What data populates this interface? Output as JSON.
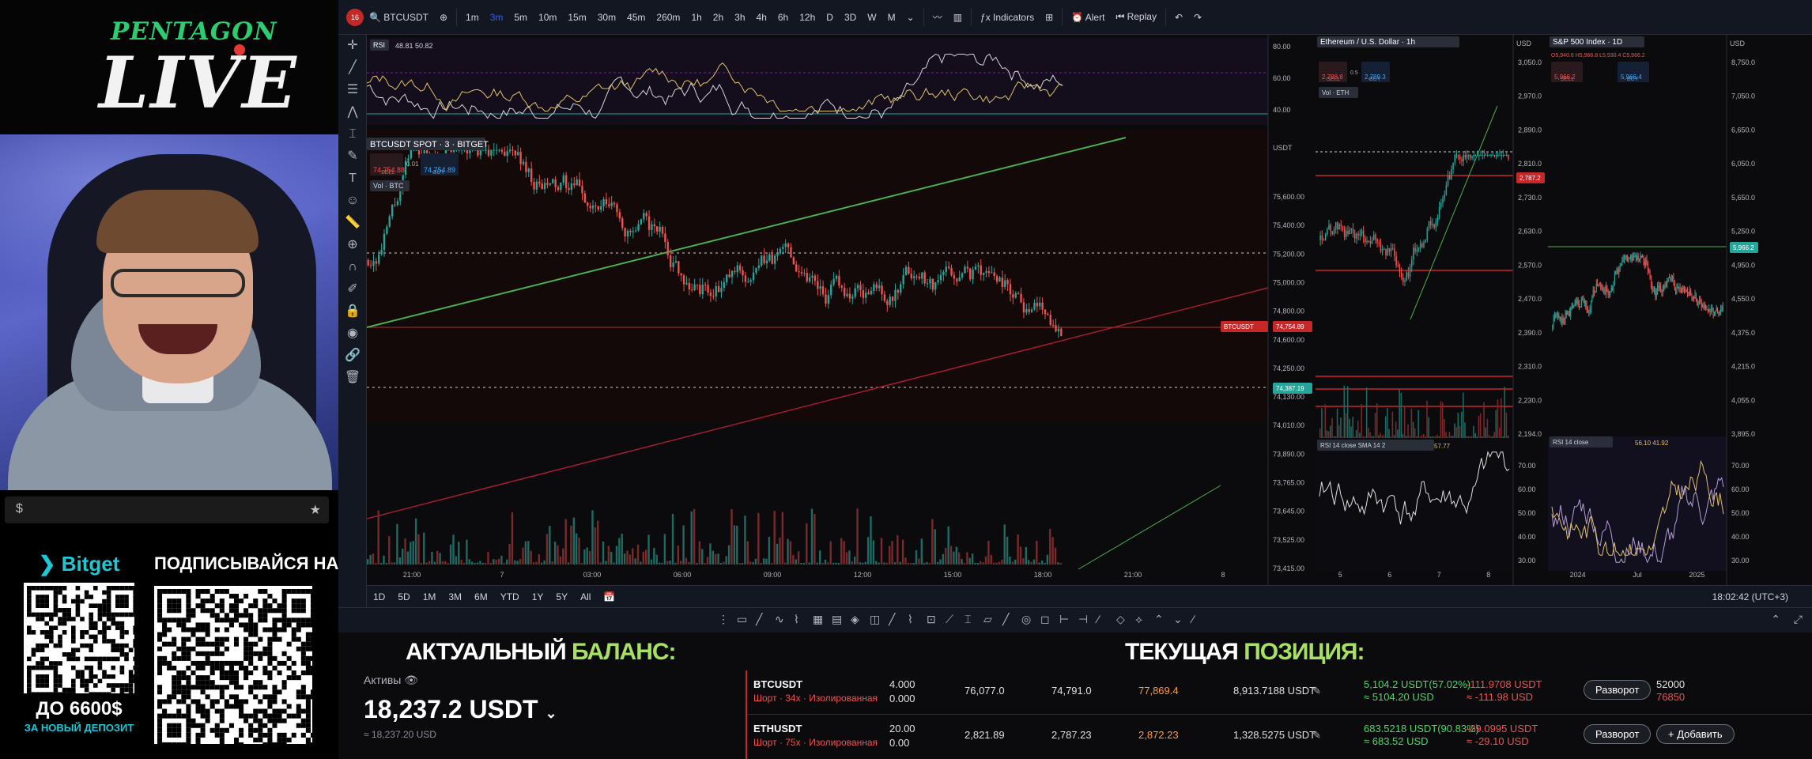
{
  "overlay": {
    "brand": "PENTAGON",
    "live": "LIVE",
    "chat_prefix": "$",
    "chat_star": "★",
    "bitget_title": "Bitget",
    "bitget_caption1": "ДО 6600$",
    "bitget_caption2": "ЗА НОВЫЙ ДЕПОЗИТ",
    "subscribe_title": "ПОДПИСЫВАЙСЯ НА"
  },
  "topbar": {
    "notif_count": "16",
    "symbol": "BTCUSDT",
    "intervals": [
      "1m",
      "3m",
      "5m",
      "10m",
      "15m",
      "30m",
      "45m",
      "260m",
      "1h",
      "2h",
      "3h",
      "4h",
      "6h",
      "12h",
      "D",
      "3D",
      "W",
      "M"
    ],
    "active_interval": "3m",
    "indicators": "Indicators",
    "alert": "Alert",
    "replay": "Replay"
  },
  "main_chart": {
    "rsi_label": "RSI",
    "rsi_values": "48.81  50.82",
    "rsi_ticks": [
      "80.00",
      "60.00",
      "40.00"
    ],
    "title": "BTCUSDT SPOT · 3 · BITGET",
    "sell_price": "74,754.88",
    "sell_label": "SELL",
    "spread": "0.01",
    "buy_price": "74,754.89",
    "buy_label": "BUY",
    "volume_label": "Vol · BTC",
    "currency": "USDT",
    "price_ticks": [
      "75,600.00",
      "75,400.00",
      "75,200.00",
      "75,000.00",
      "74,800.00",
      "74,600.00",
      "74,250.00",
      "74,130.00",
      "74,010.00",
      "73,890.00",
      "73,765.00",
      "73,645.00",
      "73,525.00",
      "73,415.00"
    ],
    "last_price": "74,754.89",
    "last_symbol": "BTCUSDT",
    "level_price": "74,387.19",
    "time_ticks": [
      "21:00",
      "7",
      "03:00",
      "06:00",
      "09:00",
      "12:00",
      "15:00",
      "18:00",
      "21:00",
      "8"
    ]
  },
  "eth_chart": {
    "title": "Ethereum / U.S. Dollar · 1h",
    "sell_price": "2,788.8",
    "sell_label": "SELL",
    "spread": "0.5",
    "buy_price": "2,789.3",
    "buy_label": "BUY",
    "volume_label": "Vol · ETH",
    "currency": "USD",
    "price_ticks": [
      "3,050.0",
      "2,970.0",
      "2,890.0",
      "2,810.0",
      "2,730.0",
      "2,630.0",
      "2,570.0",
      "2,470.0",
      "2,390.0",
      "2,310.0",
      "2,230.0",
      "2,194.0"
    ],
    "last_price": "2,787.2",
    "rsi_label": "RSI 14 close SMA 14 2",
    "rsi_values": "57.77",
    "rsi_ticks": [
      "70.00",
      "60.00",
      "50.00",
      "40.00",
      "30.00"
    ],
    "time_ticks": [
      "5",
      "6",
      "7",
      "8"
    ]
  },
  "spx_chart": {
    "title": "S&P 500 Index · 1D",
    "ohlc": "O5,940.6  H5,966.8  L5,930.4  C5,966.2",
    "sell_price": "5,966.2",
    "sell_label": "SELL",
    "buy_price": "5,966.4",
    "buy_label": "BUY",
    "currency": "USD",
    "price_ticks": [
      "8,750.0",
      "7,050.0",
      "6,650.0",
      "6,050.0",
      "5,650.0",
      "5,250.0",
      "4,950.0",
      "4,550.0",
      "4,375.0",
      "4,215.0",
      "4,055.0",
      "3,895.0"
    ],
    "last_price": "5,966.2",
    "rsi_label": "RSI 14 close",
    "rsi_values": "56.10  41.92",
    "rsi_ticks": [
      "70.00",
      "60.00",
      "50.00",
      "40.00",
      "30.00"
    ],
    "time_ticks": [
      "2024",
      "Jul",
      "2025"
    ]
  },
  "bottombar": {
    "ranges": [
      "1D",
      "5D",
      "1M",
      "3M",
      "6M",
      "YTD",
      "1Y",
      "5Y",
      "All"
    ],
    "clock": "18:02:42 (UTC+3)"
  },
  "panel": {
    "balance_header_1": "АКТУАЛЬНЫЙ ",
    "balance_header_2": "БАЛАНС:",
    "position_header_1": "ТЕКУЩАЯ ",
    "position_header_2": "ПОЗИЦИЯ:",
    "assets_label": "Активы",
    "balance": "18,237.2 USDT",
    "balance_usd": "≈ 18,237.20 USD",
    "positions": [
      {
        "symbol": "BTCUSDT",
        "side": "Шорт · 34x · Изолированная",
        "qty": "4.000",
        "qty2": "0.000",
        "entry": "76,077.0",
        "mark": "74,791.0",
        "liq": "77,869.4",
        "margin": "8,913.7188 USDT",
        "pnl": "5,104.2 USDT(57.02%)",
        "pnl_usd": "≈ 5104.20 USD",
        "realized": "-111.9708 USDT",
        "realized_usd": "≈ -111.98 USD",
        "btn": "Разворот",
        "tp": "52000",
        "sl": "76850"
      },
      {
        "symbol": "ETHUSDT",
        "side": "Шорт · 75x · Изолированная",
        "qty": "20.00",
        "qty2": "0.00",
        "entry": "2,821.89",
        "mark": "2,787.23",
        "liq": "2,872.23",
        "margin": "1,328.5275 USDT",
        "pnl": "683.5218 USDT(90.83%)",
        "pnl_usd": "≈ 683.52 USD",
        "realized": "-29.0995 USDT",
        "realized_usd": "≈ -29.10 USD",
        "btn": "Разворот",
        "add": "+ Добавить"
      }
    ]
  },
  "colors": {
    "accent": "#2962ff",
    "up": "#26a69a",
    "down": "#ef5350",
    "highlight": "#a8e063",
    "brand_green": "#2ecc71",
    "bitget": "#1fc7d4"
  }
}
